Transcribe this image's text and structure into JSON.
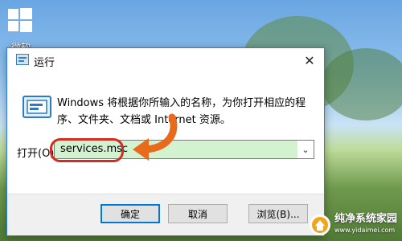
{
  "desktop": {
    "icon_label": "微软"
  },
  "dialog": {
    "title": "运行",
    "close_glyph": "✕",
    "description": "Windows 将根据你所输入的名称，为你打开相应的程序、文件夹、文档或 Internet 资源。",
    "open_label": "打开(O):",
    "input_value": "services.msc",
    "dropdown_glyph": "⌄",
    "buttons": {
      "ok": "确定",
      "cancel": "取消",
      "browse": "浏览(B)..."
    }
  },
  "watermark": {
    "text": "纯净系统家园",
    "url": "www.yidaimei.com"
  },
  "colors": {
    "accent": "#0078d7",
    "highlight": "#d62a25",
    "arrow": "#e86a1c",
    "selection": "#d3f2cf"
  },
  "icons": [
    "windows-logo-icon",
    "run-icon",
    "close-icon",
    "chevron-down-icon",
    "curved-arrow-icon"
  ]
}
